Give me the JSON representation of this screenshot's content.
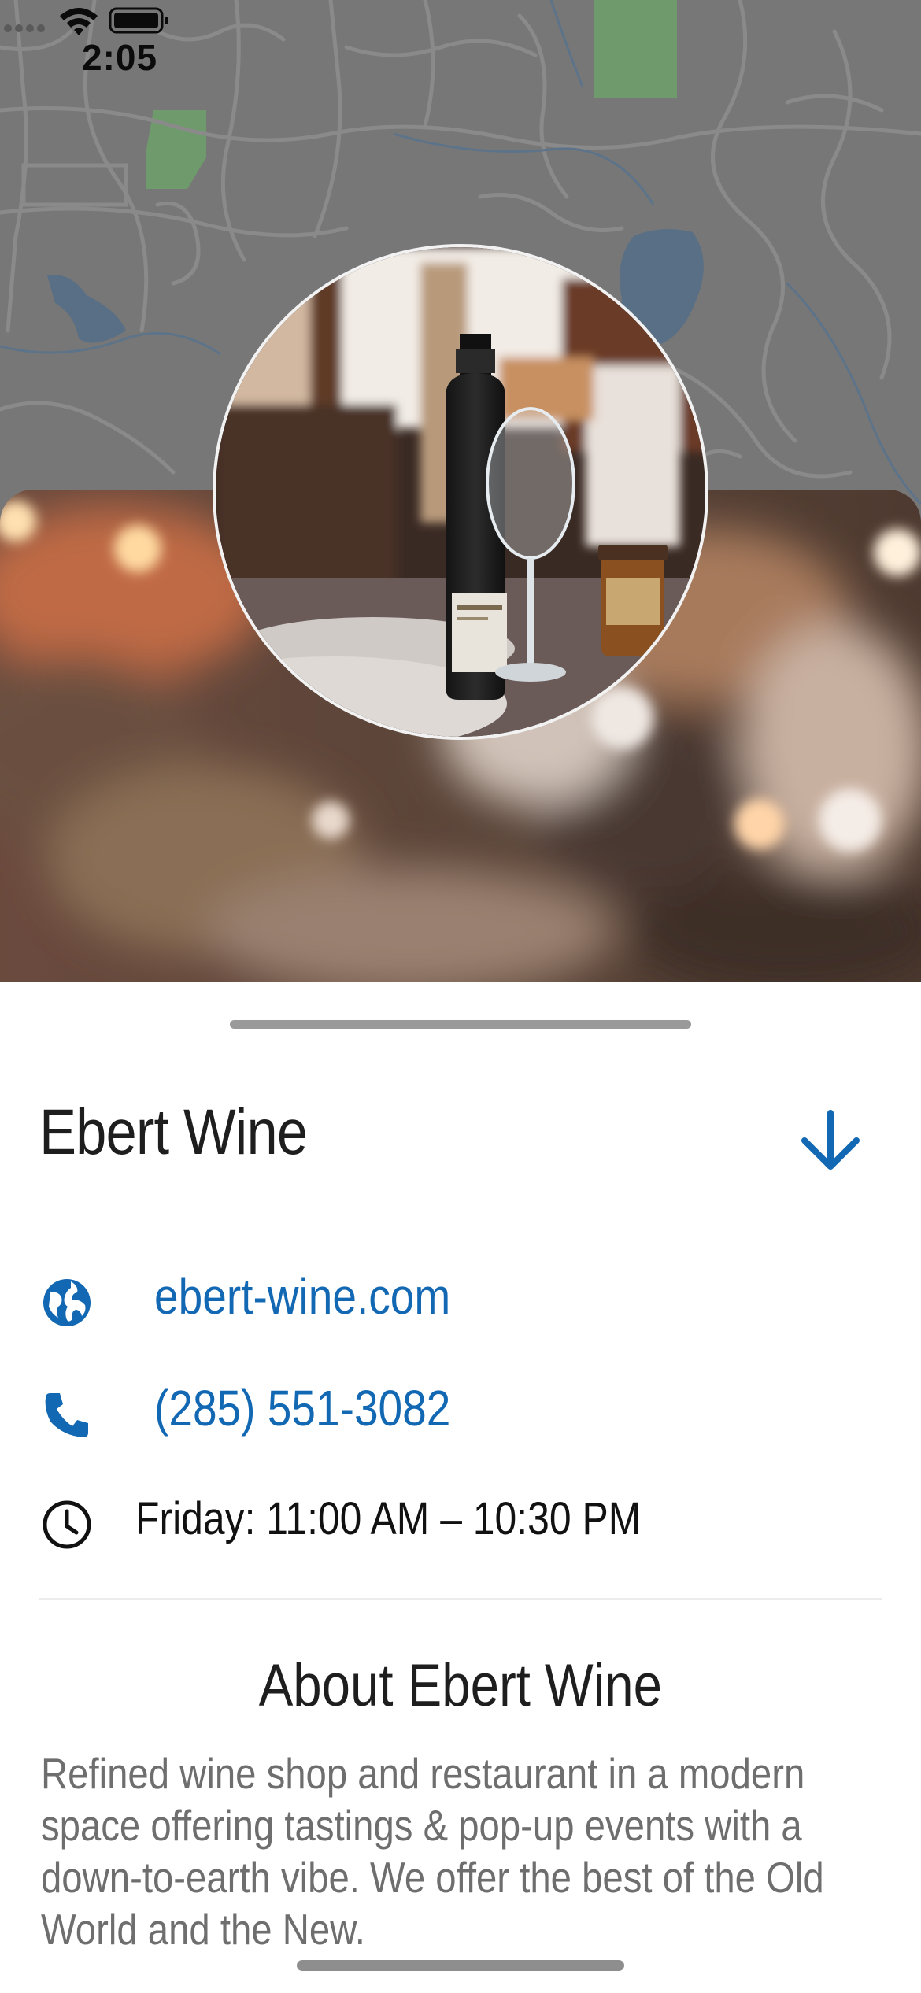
{
  "status_bar": {
    "time": "2:05"
  },
  "place": {
    "name": "Ebert Wine",
    "website": "ebert-wine.com",
    "phone": "(285) 551-3082",
    "hours": "Friday: 11:00 AM – 10:30 PM"
  },
  "about": {
    "title": "About Ebert Wine",
    "description": "Refined wine shop and restaurant in a modern space offering tastings & pop-up events with a down-to-earth vibe. We offer the best of the Old World and the New."
  },
  "icons": {
    "website": "globe-icon",
    "phone": "phone-icon",
    "hours": "clock-icon",
    "collapse": "arrow-down-icon"
  },
  "colors": {
    "accent": "#1268b3",
    "map": "#767676"
  }
}
